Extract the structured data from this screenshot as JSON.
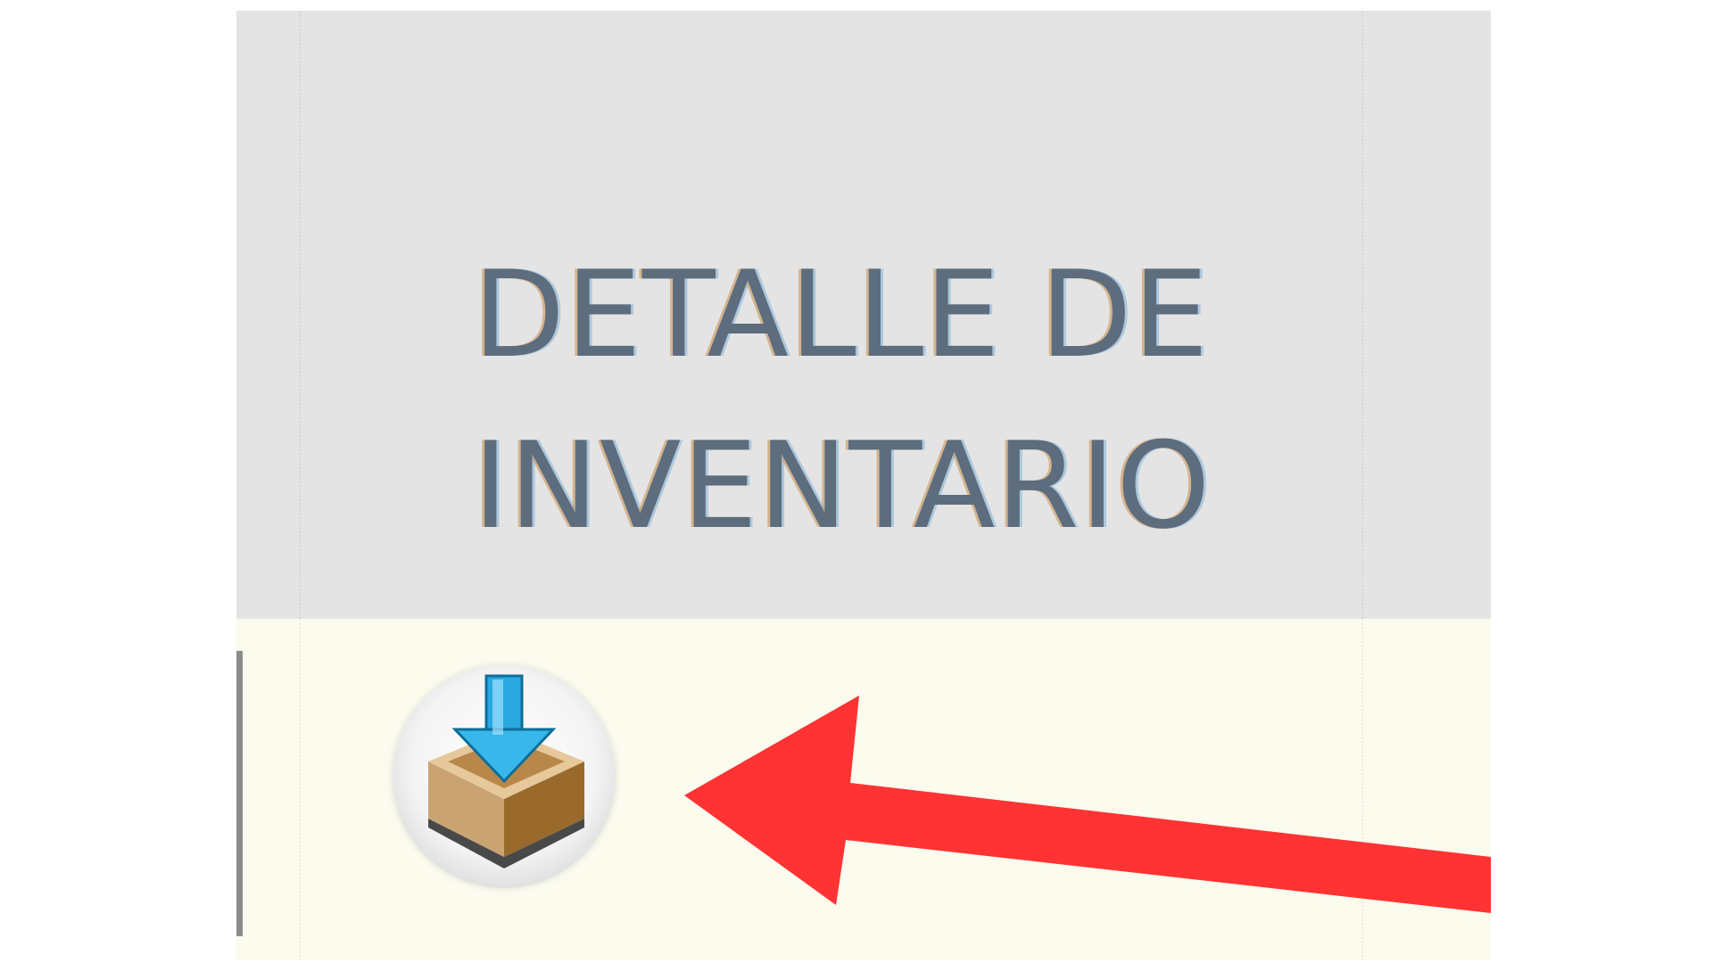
{
  "table": {
    "header": {
      "title_line1": "DETALLE DE",
      "title_line2": "INVENTARIO"
    },
    "row": {
      "action_icon": "download-box-icon"
    }
  },
  "annotation": {
    "arrow_icon": "red-arrow-icon",
    "arrow_color": "#ff3333"
  },
  "colors": {
    "header_bg": "#e4e4e4",
    "row_bg": "#fbfbee",
    "header_text": "#5d6d7e",
    "box_brown": "#c9a472",
    "arrow_blue": "#2aa8e0"
  }
}
